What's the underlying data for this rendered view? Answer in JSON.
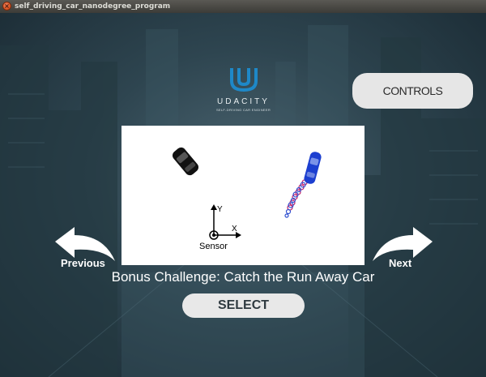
{
  "window": {
    "title": "self_driving_car_nanodegree_program",
    "close_glyph": "×"
  },
  "logo": {
    "word": "UDACITY",
    "subtitle": "SELF-DRIVING CAR ENGINEER"
  },
  "buttons": {
    "controls": "CONTROLS",
    "select": "SELECT"
  },
  "nav": {
    "previous": "Previous",
    "next": "Next"
  },
  "preview": {
    "sensor_label": "Sensor",
    "axis_y": "Y",
    "axis_x": "X",
    "caption": "Bonus Challenge: Catch the Run Away Car"
  },
  "colors": {
    "accent_blue": "#1e88c8",
    "button_bg": "#e6e6e6",
    "background": "#2e4550"
  }
}
